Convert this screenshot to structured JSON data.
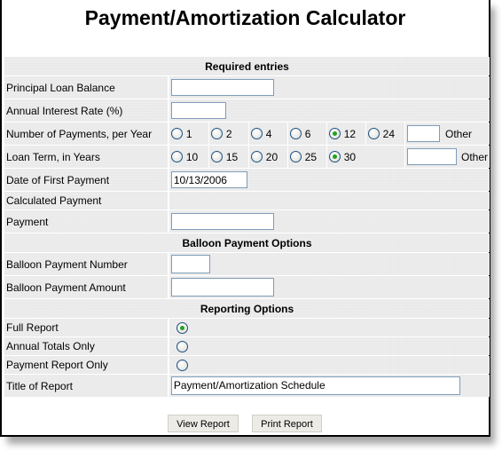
{
  "page": {
    "title": "Payment/Amortization Calculator"
  },
  "sections": {
    "required": "Required entries",
    "balloon": "Balloon Payment Options",
    "reporting": "Reporting Options"
  },
  "fields": {
    "principal": {
      "label": "Principal Loan Balance",
      "value": ""
    },
    "interest": {
      "label": "Annual Interest Rate (%)",
      "value": ""
    },
    "payments_per_year": {
      "label": "Number of Payments, per Year",
      "options": [
        "1",
        "2",
        "4",
        "6",
        "12",
        "24"
      ],
      "selected": "12",
      "other_label": "Other",
      "other_value": ""
    },
    "loan_term": {
      "label": "Loan Term, in Years",
      "options": [
        "10",
        "15",
        "20",
        "25",
        "30"
      ],
      "selected": "30",
      "other_label": "Other",
      "other_value": ""
    },
    "first_payment_date": {
      "label": "Date of First Payment",
      "value": "10/13/2006"
    },
    "calculated_payment": {
      "label": "Calculated Payment"
    },
    "payment": {
      "label": "Payment",
      "value": ""
    },
    "balloon_number": {
      "label": "Balloon Payment Number",
      "value": ""
    },
    "balloon_amount": {
      "label": "Balloon Payment Amount",
      "value": ""
    },
    "report_type": {
      "options": [
        "Full Report",
        "Annual Totals Only",
        "Payment Report Only"
      ],
      "selected": "Full Report"
    },
    "report_title": {
      "label": "Title of Report",
      "value": "Payment/Amortization Schedule"
    }
  },
  "buttons": {
    "view": "View Report",
    "print": "Print Report"
  },
  "colors": {
    "radio_checked": "#21a121",
    "input_border": "#7f9db9",
    "row_bg": "#ececec"
  }
}
